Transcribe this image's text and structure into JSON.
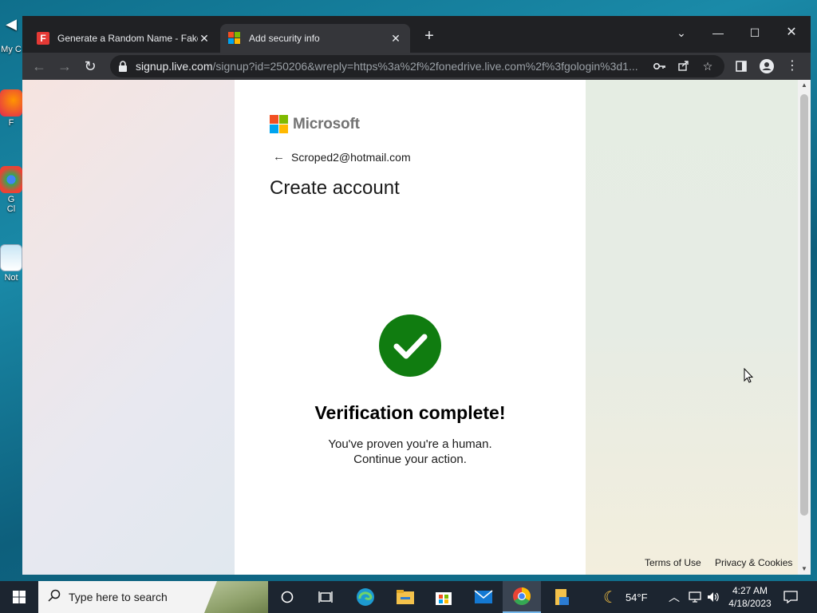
{
  "desktop": {
    "icons": [
      {
        "label": "My C"
      },
      {
        "label": "F"
      },
      {
        "label": "G\nCl"
      },
      {
        "label": "Not"
      }
    ]
  },
  "browser": {
    "tabs": [
      {
        "title": "Generate a Random Name - Fake",
        "favicon": "fake-name-favicon",
        "active": false
      },
      {
        "title": "Add security info",
        "favicon": "microsoft-favicon",
        "active": true
      }
    ],
    "url_host": "signup.live.com",
    "url_path": "/signup?id=250206&wreply=https%3a%2f%2fonedrive.live.com%2f%3fgologin%3d1..."
  },
  "page": {
    "brand": "Microsoft",
    "identity": "Scroped2@hotmail.com",
    "title": "Create account",
    "verification_title": "Verification complete!",
    "verification_line1": "You've proven you're a human.",
    "verification_line2": "Continue your action.",
    "terms_link": "Terms of Use",
    "privacy_link": "Privacy & Cookies"
  },
  "taskbar": {
    "search_placeholder": "Type here to search",
    "weather_temp": "54°F",
    "time": "4:27 AM",
    "date": "4/18/2023"
  },
  "colors": {
    "ms_red": "#f25022",
    "ms_green": "#7fba00",
    "ms_blue": "#00a4ef",
    "ms_yellow": "#ffb900",
    "success_green": "#107c10",
    "chrome_dark": "#202124",
    "chrome_toolbar": "#35363a"
  }
}
